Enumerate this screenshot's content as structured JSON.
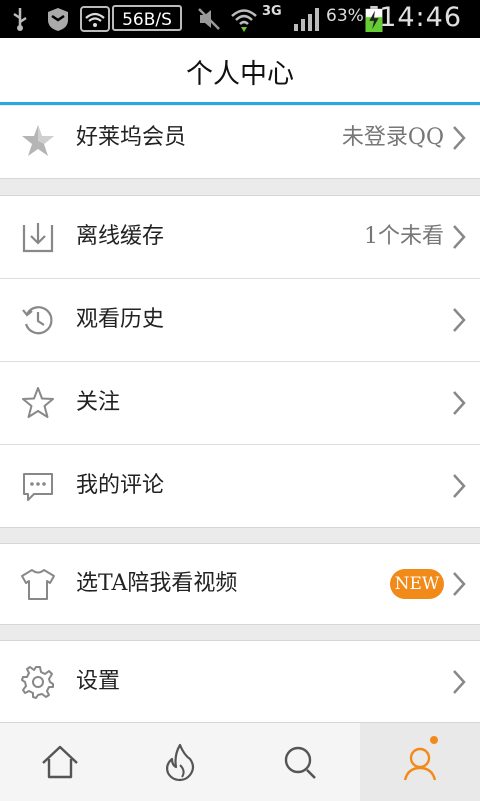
{
  "status_bar": {
    "network_speed": "56B/S",
    "signal_type": "3G",
    "battery_percent": "63%",
    "time": "14:46"
  },
  "header": {
    "title": "个人中心"
  },
  "member": {
    "label": "好莱坞会员",
    "value": "未登录QQ"
  },
  "offline": {
    "label": "离线缓存",
    "value": "1个未看"
  },
  "history": {
    "label": "观看历史"
  },
  "follow": {
    "label": "关注"
  },
  "comments": {
    "label": "我的评论"
  },
  "ta_video": {
    "label": "选TA陪我看视频",
    "badge": "NEW"
  },
  "settings": {
    "label": "设置"
  },
  "tabs": [
    {
      "icon": "home-icon"
    },
    {
      "icon": "fire-icon"
    },
    {
      "icon": "search-icon"
    },
    {
      "icon": "profile-icon"
    }
  ],
  "colors": {
    "accent": "#29a9e1",
    "badge": "#f28a1a"
  }
}
